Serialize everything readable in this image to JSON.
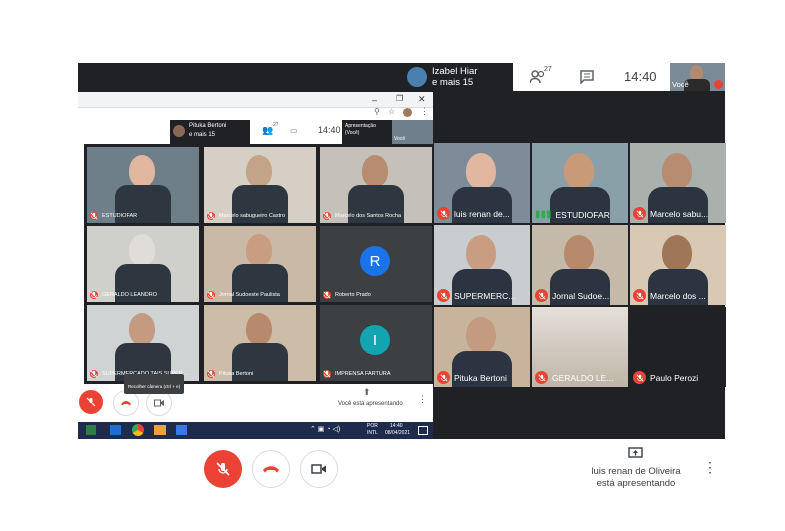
{
  "presenter": {
    "name_line1": "Izabel Hiar",
    "name_line2": "e mais 15"
  },
  "header": {
    "participants_count": "27",
    "time": "14:40",
    "self_label": "Você"
  },
  "inner_header": {
    "name_line1": "Pituka Bertoni",
    "name_line2": "e mais 15",
    "participants_count": "27",
    "time": "14:40",
    "self_label": "Apresentação (Você)",
    "self_label2": "Você"
  },
  "right_tiles": [
    {
      "name": "luis renan de..."
    },
    {
      "name": "ESTUDIOFAR"
    },
    {
      "name": "Marcelo sabu..."
    },
    {
      "name": "SUPERMERC..."
    },
    {
      "name": "Jornal Sudoe..."
    },
    {
      "name": "Marcelo dos ..."
    },
    {
      "name": "Pituka Bertoni"
    },
    {
      "name": "GERALDO LE..."
    },
    {
      "name": "Paulo Perozi"
    }
  ],
  "inner_tiles": [
    {
      "name": "ESTUDIOFAR"
    },
    {
      "name": "Marcelo sabugueiro Castro"
    },
    {
      "name": "Marcelo dos Santos Rocha"
    },
    {
      "name": "GERALDO LEANDRO"
    },
    {
      "name": "Jornal Sudoeste Paulista"
    },
    {
      "name": "Roberto Prado",
      "initial": "R"
    },
    {
      "name": "SUPERMERCADO TAIS SUPER..."
    },
    {
      "name": "Pituka Bertoni"
    },
    {
      "name": "IMPRENSA FARTURA",
      "initial": "I"
    }
  ],
  "inner_controls": {
    "tooltip": "Recolher câmera (ctrl + e)",
    "presenting_note": "Você está apresentando"
  },
  "taskbar": {
    "lang_line1": "POR",
    "lang_line2": "INTL",
    "clock_time": "14:40",
    "clock_date": "08/04/2021"
  },
  "footer": {
    "presenting_line1": "luis renan de Oliveira",
    "presenting_line2": "está apresentando"
  },
  "colors": {
    "red": "#ea4335",
    "dark": "#202124",
    "avatar_r": "#1a73e8",
    "avatar_i": "#12a4af"
  }
}
